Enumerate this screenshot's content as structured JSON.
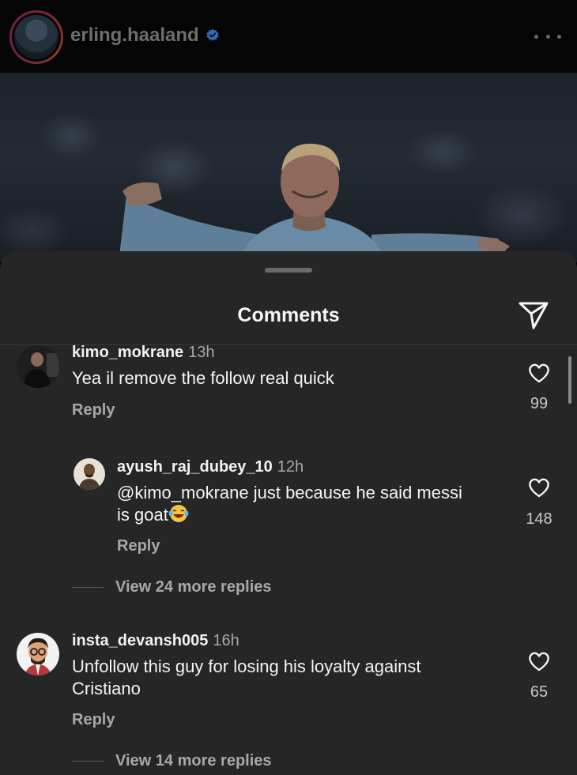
{
  "header": {
    "username": "erling.haaland"
  },
  "sheet": {
    "title": "Comments"
  },
  "comments": [
    {
      "user": "kimo_mokrane",
      "time": "13h",
      "text": "Yea il remove the follow real quick",
      "reply_label": "Reply",
      "likes": "99"
    },
    {
      "user": "ayush_raj_dubey_10",
      "time": "12h",
      "text_line1": "@kimo_mokrane just because he said messi",
      "text_line2": "is goat",
      "reply_label": "Reply",
      "likes": "148",
      "is_reply": true
    },
    {
      "user": "insta_devansh005",
      "time": "16h",
      "text_line1": "Unfollow this guy for losing his loyalty against",
      "text_line2": "Cristiano",
      "reply_label": "Reply",
      "likes": "65"
    }
  ],
  "view_more": [
    "View 24 more replies",
    "View 14 more replies"
  ],
  "colors": {
    "sheet_bg": "#262626",
    "secondary_text": "#a8a8a8",
    "verified_blue": "#3897f0"
  }
}
